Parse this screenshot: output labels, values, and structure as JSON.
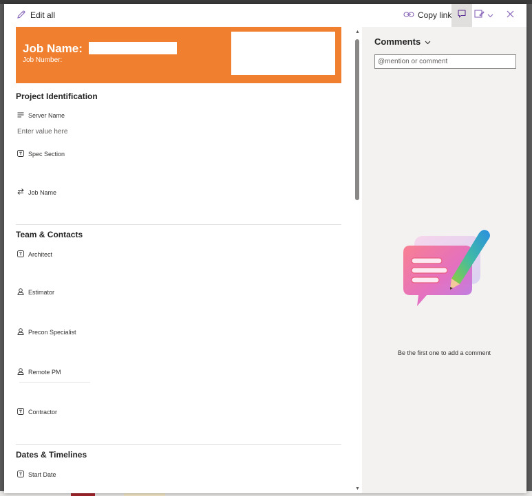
{
  "toolbar": {
    "edit_all_label": "Edit all",
    "copy_link_label": "Copy link"
  },
  "header": {
    "job_name_label": "Job Name:",
    "job_number_label": "Job Number:"
  },
  "sections": {
    "project_identification": "Project Identification",
    "team_contacts": "Team & Contacts",
    "dates_timelines": "Dates & Timelines"
  },
  "fields": {
    "server_name": {
      "label": "Server Name",
      "placeholder": "Enter value here"
    },
    "spec_section": {
      "label": "Spec Section"
    },
    "job_name": {
      "label": "Job Name"
    },
    "architect": {
      "label": "Architect"
    },
    "estimator": {
      "label": "Estimator"
    },
    "precon_specialist": {
      "label": "Precon Specialist"
    },
    "remote_pm": {
      "label": "Remote PM"
    },
    "contractor": {
      "label": "Contractor"
    },
    "start_date": {
      "label": "Start Date"
    }
  },
  "comments": {
    "title": "Comments",
    "placeholder": "@mention or comment",
    "empty_message": "Be the first one to add a comment"
  },
  "colors": {
    "banner": "#f0802f",
    "accent": "#6264a7"
  }
}
